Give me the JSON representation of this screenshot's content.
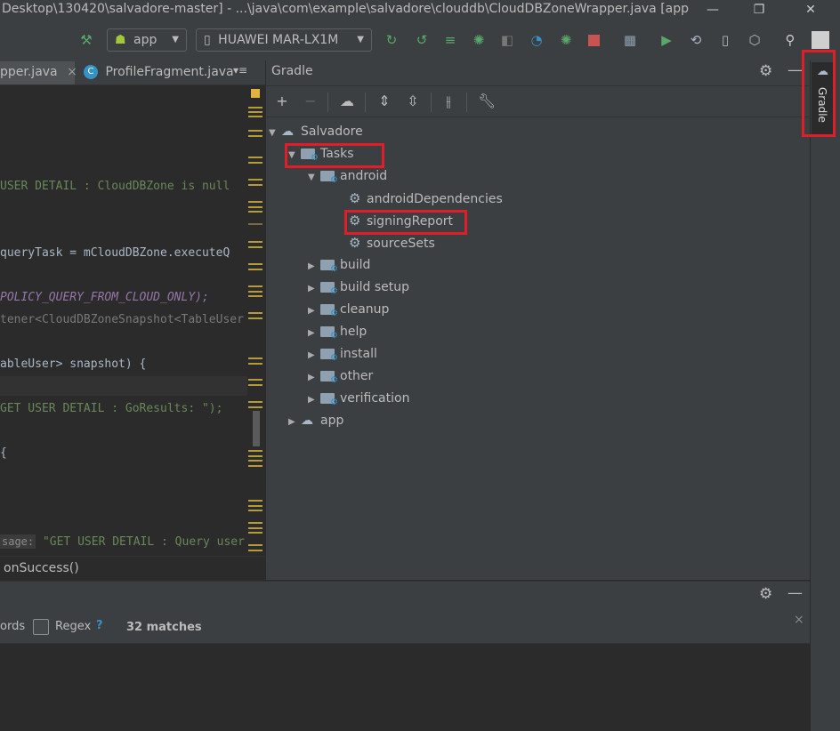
{
  "window": {
    "title": "Desktop\\130420\\salvadore-master] - ...\\java\\com\\example\\salvadore\\clouddb\\CloudDBZoneWrapper.java [app",
    "minimize": "—",
    "restore": "❐",
    "close": "✕"
  },
  "toolbar": {
    "run_config": "app",
    "device": "HUAWEI MAR-LX1M",
    "icons": [
      "hammer-icon",
      "android-icon",
      "phone-icon",
      "apply-changes-icon",
      "apply-code-changes-icon",
      "sync-icon",
      "debug-icon",
      "attach-icon",
      "profile-icon",
      "run-tests-icon",
      "stop-icon",
      "project-structure-icon",
      "avd-icon",
      "gradle-sync-icon",
      "device-manager-icon",
      "sdk-icon",
      "search-icon",
      "avatar"
    ]
  },
  "editor": {
    "tabs": [
      {
        "label": "pper.java",
        "close": "×"
      },
      {
        "label": "ProfileFragment.java",
        "icon_letter": "C"
      }
    ],
    "tab_menu": "▾≡",
    "lines": [
      {
        "text": "USER DETAIL : CloudDBZone is null",
        "color": "#6a8759"
      },
      {
        "text": " queryTask = mCloudDBZone.executeQ",
        "color": "#a9b7c6"
      },
      {
        "text": " POLICY_QUERY_FROM_CLOUD_ONLY);",
        "color": "#9876aa"
      },
      {
        "text": "tener<CloudDBZoneSnapshot<TableUser",
        "color": "#787878"
      },
      {
        "text": "ableUser> snapshot) {",
        "color": "#a9b7c6"
      },
      {
        "text": "GET USER DETAIL : GoResults: \");",
        "color": "#6a8759"
      },
      {
        "text": " {",
        "color": "#a9b7c6"
      },
      {
        "text": "\"GET USER DETAIL : Query user",
        "color": "#6a8759"
      }
    ],
    "param_hint": "sage:",
    "breadcrumb": "onSuccess()"
  },
  "gradle": {
    "title": "Gradle",
    "tree": [
      {
        "label": "Salvadore",
        "expanded": true
      },
      {
        "label": "Tasks",
        "expanded": true
      },
      {
        "label": "android",
        "expanded": true
      },
      {
        "label": "androidDependencies"
      },
      {
        "label": "signingReport"
      },
      {
        "label": "sourceSets"
      },
      {
        "label": "build",
        "expanded": false
      },
      {
        "label": "build setup",
        "expanded": false
      },
      {
        "label": "cleanup",
        "expanded": false
      },
      {
        "label": "help",
        "expanded": false
      },
      {
        "label": "install",
        "expanded": false
      },
      {
        "label": "other",
        "expanded": false
      },
      {
        "label": "verification",
        "expanded": false
      },
      {
        "label": "app",
        "expanded": false
      }
    ],
    "side_tab": "Gradle"
  },
  "find": {
    "words_label": "ords",
    "regex_label": "Regex",
    "help": "?",
    "matches": "32 matches",
    "close": "×"
  },
  "colors": {
    "highlight": "#e01e2a",
    "accent_green": "#59a869",
    "accent_blue": "#3592c4"
  }
}
